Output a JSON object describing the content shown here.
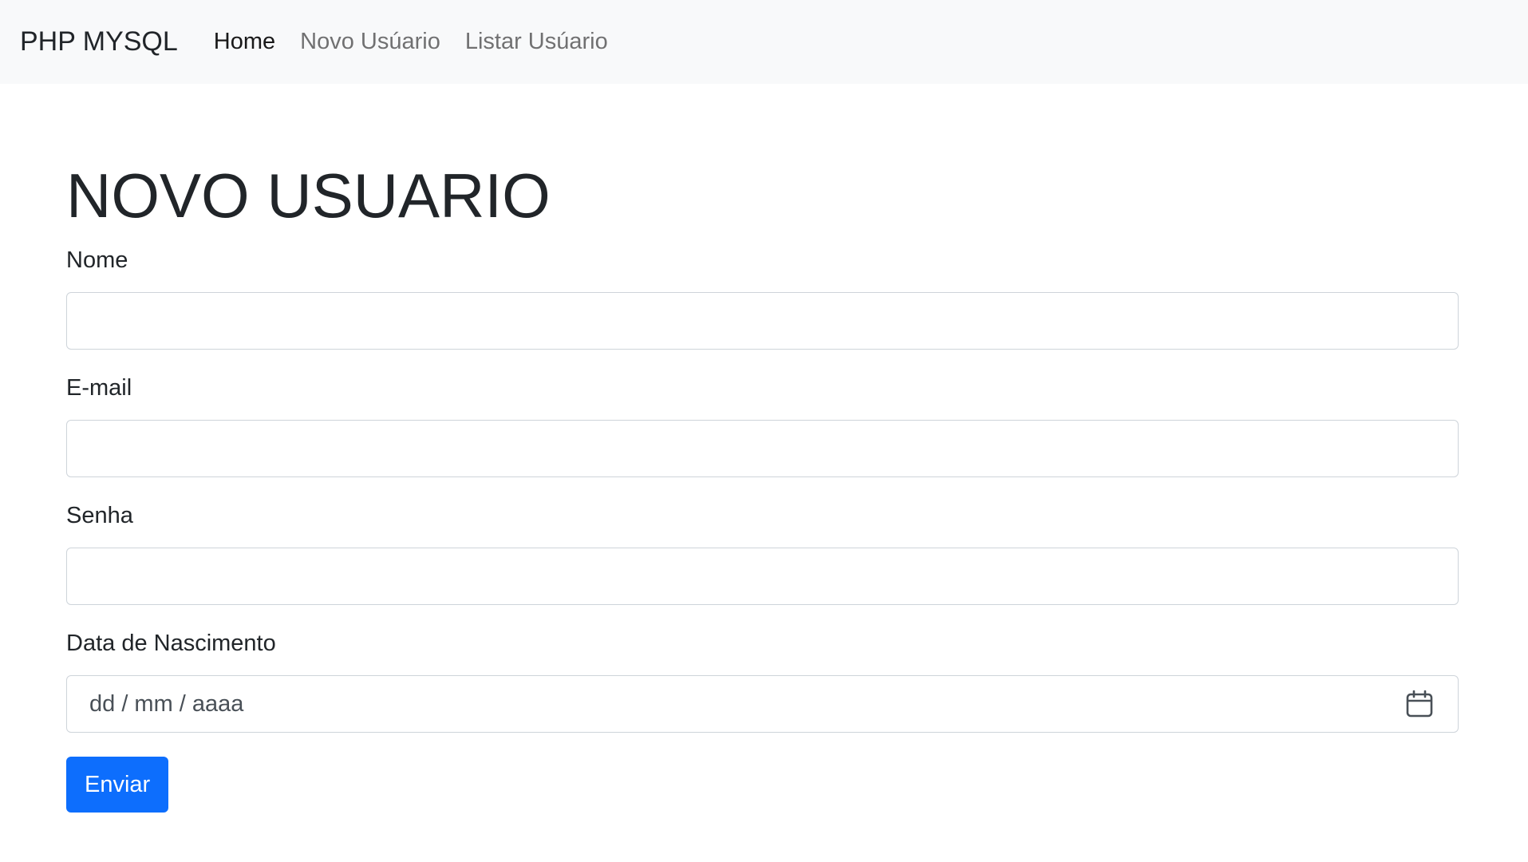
{
  "navbar": {
    "brand": "PHP MYSQL",
    "links": [
      {
        "label": "Home",
        "active": true
      },
      {
        "label": "Novo Usúario",
        "active": false
      },
      {
        "label": "Listar Usúario",
        "active": false
      }
    ]
  },
  "page": {
    "title": "NOVO USUARIO"
  },
  "form": {
    "nome": {
      "label": "Nome",
      "value": ""
    },
    "email": {
      "label": "E-mail",
      "value": ""
    },
    "senha": {
      "label": "Senha",
      "value": ""
    },
    "nascimento": {
      "label": "Data de Nascimento",
      "placeholder": "dd / mm / aaaa",
      "value": ""
    },
    "submit_label": "Enviar"
  },
  "colors": {
    "navbar_bg": "#f8f9fa",
    "primary_button": "#0d6efd",
    "input_border": "#ced4da"
  },
  "icons": {
    "date_picker": "calendar-icon"
  }
}
